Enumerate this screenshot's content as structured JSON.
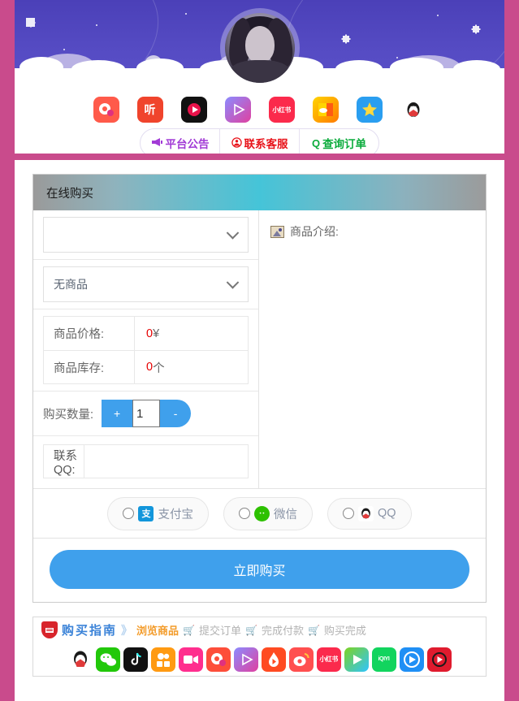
{
  "theme": {
    "frame_pink": "#c94b8c",
    "accent_blue": "#3fa0ec",
    "header_purple": "#4b40b8"
  },
  "header": {
    "avatar_name": "avatar",
    "app_icons": [
      {
        "name": "kugou-icon",
        "label": "",
        "bg": "#ff5a4a",
        "fg": "#ffffff"
      },
      {
        "name": "ximalaya-icon",
        "label": "听",
        "bg": "#f0442c",
        "fg": "#ffffff"
      },
      {
        "name": "douyin-icon",
        "label": "",
        "bg": "#111111",
        "fg": "#ffffff"
      },
      {
        "name": "bilibili-icon",
        "label": "",
        "bg": "#7f7bff",
        "fg": "#ffffff"
      },
      {
        "name": "xiaohongshu-icon",
        "label": "小红书",
        "bg": "#fb2a4c",
        "fg": "#ffffff"
      },
      {
        "name": "kuaishou-icon",
        "label": "",
        "bg": "#ff8a00",
        "fg": "#ffffff"
      },
      {
        "name": "qqmusic-star-icon",
        "label": "",
        "bg": "#2a9ef0",
        "fg": "#ffd93d"
      },
      {
        "name": "qq-icon",
        "label": "",
        "bg": "#ffffff",
        "fg": "#000000"
      }
    ],
    "nav": [
      {
        "name": "nav-announcement",
        "icon": "📢",
        "label": "平台公告",
        "color": "#a23bd6"
      },
      {
        "name": "nav-customer-service",
        "icon": "☻",
        "label": "联系客服",
        "color": "#e8131a"
      },
      {
        "name": "nav-query-order",
        "icon": "Q",
        "label": "查询订单",
        "color": "#0bab3c"
      }
    ]
  },
  "card": {
    "title": "在线购买",
    "category_select": {
      "value": "",
      "placeholder": ""
    },
    "product_select": {
      "value": "无商品"
    },
    "rows": [
      {
        "key": "商品价格:",
        "num": "0",
        "unit": "¥"
      },
      {
        "key": "商品库存:",
        "num": "0",
        "unit": "个"
      }
    ],
    "quantity": {
      "label": "购买数量:",
      "plus": "+",
      "minus": "-",
      "value": "1"
    },
    "contact": {
      "label": "联系QQ:",
      "value": "",
      "placeholder": ""
    },
    "intro": {
      "label": "商品介绍:",
      "icon": "image-icon"
    },
    "payments": [
      {
        "name": "payment-alipay",
        "label": "支付宝",
        "icon_text": "支",
        "icon_bg": "#1296db"
      },
      {
        "name": "payment-wechat",
        "label": "微信",
        "icon_text": "",
        "icon_bg": "#2dc100"
      },
      {
        "name": "payment-qq",
        "label": "QQ",
        "icon_text": "",
        "icon_bg": "#ffffff"
      }
    ],
    "buy_button": "立即购买"
  },
  "guide": {
    "badge": "🛒",
    "title": "购买指南",
    "arrows": "》",
    "steps": [
      {
        "label": "浏览商品",
        "active": true
      },
      {
        "label": "提交订单",
        "active": false
      },
      {
        "label": "完成付款",
        "active": false
      },
      {
        "label": "购买完成",
        "active": false
      }
    ],
    "cart_sep": "🛒"
  },
  "bottom_apps": [
    {
      "name": "qq-icon",
      "label": "",
      "bg": "#ffffff"
    },
    {
      "name": "wechat-icon",
      "label": "",
      "bg": "#22c80a"
    },
    {
      "name": "tiktok-icon",
      "label": "",
      "bg": "#111111"
    },
    {
      "name": "kuaishou-icon",
      "label": "",
      "bg": "#ff9a12"
    },
    {
      "name": "meipai-icon",
      "label": "",
      "bg": "#ff2e8e"
    },
    {
      "name": "kugou-icon",
      "label": "",
      "bg": "#fd4e3a"
    },
    {
      "name": "bilibili-icon",
      "label": "",
      "bg": "#8a7bff"
    },
    {
      "name": "huoshan-icon",
      "label": "",
      "bg": "#ff4b22"
    },
    {
      "name": "weibo-icon",
      "label": "",
      "bg": "#ff4f4f"
    },
    {
      "name": "xiaohongshu-icon",
      "label": "小红书",
      "bg": "#fb2a4c"
    },
    {
      "name": "youku-icon",
      "label": "",
      "bg": "#7ed321"
    },
    {
      "name": "iqiyi-icon",
      "label": "iQIYI",
      "bg": "#12d45e"
    },
    {
      "name": "sohu-icon",
      "label": "",
      "bg": "#1f8ff5"
    },
    {
      "name": "youku-red-icon",
      "label": "",
      "bg": "#e01b2e"
    }
  ]
}
